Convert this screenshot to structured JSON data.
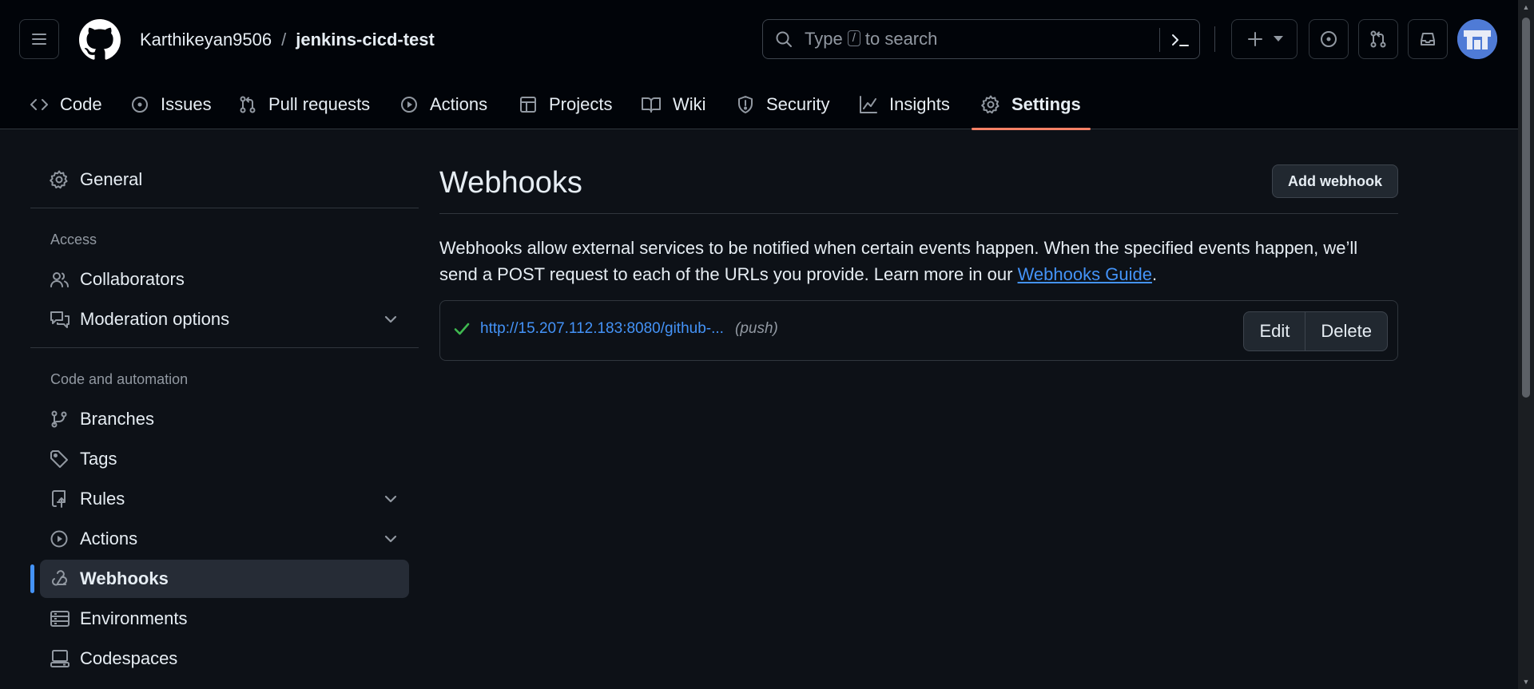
{
  "header": {
    "owner": "Karthikeyan9506",
    "separator": "/",
    "repo": "jenkins-cicd-test",
    "search": {
      "prefix": "Type",
      "key": "/",
      "suffix": "to search"
    }
  },
  "tabs": [
    {
      "label": "Code",
      "icon": "code-icon"
    },
    {
      "label": "Issues",
      "icon": "issue-opened-icon"
    },
    {
      "label": "Pull requests",
      "icon": "git-pull-request-icon"
    },
    {
      "label": "Actions",
      "icon": "play-icon"
    },
    {
      "label": "Projects",
      "icon": "table-icon"
    },
    {
      "label": "Wiki",
      "icon": "book-icon"
    },
    {
      "label": "Security",
      "icon": "shield-icon"
    },
    {
      "label": "Insights",
      "icon": "graph-icon"
    },
    {
      "label": "Settings",
      "icon": "gear-icon",
      "selected": true
    }
  ],
  "sidebar": {
    "general": "General",
    "access_heading": "Access",
    "access": [
      {
        "label": "Collaborators",
        "icon": "people-icon"
      },
      {
        "label": "Moderation options",
        "icon": "comment-discussion-icon",
        "expandable": true
      }
    ],
    "code_heading": "Code and automation",
    "code": [
      {
        "label": "Branches",
        "icon": "git-branch-icon"
      },
      {
        "label": "Tags",
        "icon": "tag-icon"
      },
      {
        "label": "Rules",
        "icon": "repo-push-icon",
        "expandable": true
      },
      {
        "label": "Actions",
        "icon": "play-icon",
        "expandable": true
      },
      {
        "label": "Webhooks",
        "icon": "webhook-icon",
        "active": true
      },
      {
        "label": "Environments",
        "icon": "server-icon"
      },
      {
        "label": "Codespaces",
        "icon": "codespaces-icon"
      }
    ]
  },
  "main": {
    "title": "Webhooks",
    "add_button": "Add webhook",
    "description_before": "Webhooks allow external services to be notified when certain events happen. When the specified events happen, we’ll send a POST request to each of the URLs you provide. Learn more in our ",
    "description_link": "Webhooks Guide",
    "description_after": ".",
    "webhooks": [
      {
        "url": "http://15.207.112.183:8080/github-...",
        "events": "(push)",
        "status": "success",
        "edit": "Edit",
        "delete": "Delete"
      }
    ]
  },
  "colors": {
    "background": "#0d1117",
    "header": "#010409",
    "accent_link": "#4493f8",
    "selected_tab_underline": "#f78166",
    "success": "#3fb950"
  }
}
